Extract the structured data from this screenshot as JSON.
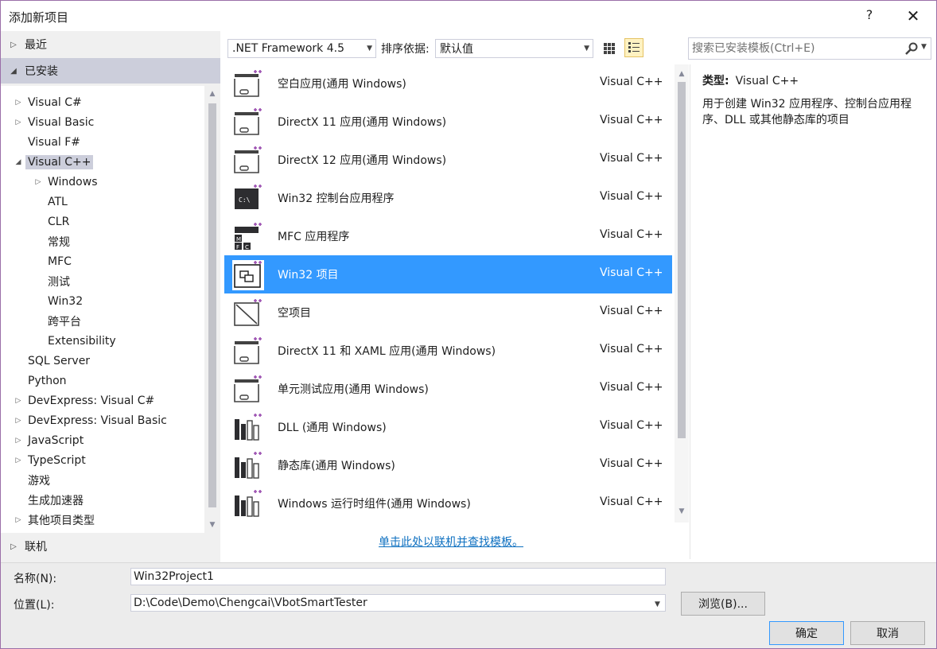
{
  "window": {
    "title": "添加新项目",
    "help_label": "?",
    "close_label": "✕"
  },
  "left": {
    "recent_label": "最近",
    "installed_label": "已安装",
    "online_label": "联机",
    "tree": [
      {
        "label": "Visual C#",
        "arrow": "▷",
        "indent": 0
      },
      {
        "label": "Visual Basic",
        "arrow": "▷",
        "indent": 0
      },
      {
        "label": "Visual F#",
        "arrow": "",
        "indent": 0
      },
      {
        "label": "Visual C++",
        "arrow": "◢",
        "indent": 0,
        "selected": true
      },
      {
        "label": "Windows",
        "arrow": "▷",
        "indent": 1
      },
      {
        "label": "ATL",
        "arrow": "",
        "indent": 1
      },
      {
        "label": "CLR",
        "arrow": "",
        "indent": 1
      },
      {
        "label": "常规",
        "arrow": "",
        "indent": 1
      },
      {
        "label": "MFC",
        "arrow": "",
        "indent": 1
      },
      {
        "label": "测试",
        "arrow": "",
        "indent": 1
      },
      {
        "label": "Win32",
        "arrow": "",
        "indent": 1
      },
      {
        "label": "跨平台",
        "arrow": "",
        "indent": 1
      },
      {
        "label": "Extensibility",
        "arrow": "",
        "indent": 1
      },
      {
        "label": "SQL Server",
        "arrow": "",
        "indent": 0
      },
      {
        "label": "Python",
        "arrow": "",
        "indent": 0
      },
      {
        "label": "DevExpress: Visual C#",
        "arrow": "▷",
        "indent": 0
      },
      {
        "label": "DevExpress: Visual Basic",
        "arrow": "▷",
        "indent": 0
      },
      {
        "label": "JavaScript",
        "arrow": "▷",
        "indent": 0
      },
      {
        "label": "TypeScript",
        "arrow": "▷",
        "indent": 0
      },
      {
        "label": "游戏",
        "arrow": "",
        "indent": 0
      },
      {
        "label": "生成加速器",
        "arrow": "",
        "indent": 0
      },
      {
        "label": "其他项目类型",
        "arrow": "▷",
        "indent": 0
      }
    ]
  },
  "toolbar": {
    "framework": ".NET Framework 4.5",
    "sort_label": "排序依据:",
    "sort_value": "默认值"
  },
  "search": {
    "placeholder": "搜索已安装模板(Ctrl+E)"
  },
  "templates": [
    {
      "name": "空白应用(通用 Windows)",
      "lang": "Visual C++",
      "icon": "blank-app-icon"
    },
    {
      "name": "DirectX 11 应用(通用 Windows)",
      "lang": "Visual C++",
      "icon": "directx-app-icon"
    },
    {
      "name": "DirectX 12 应用(通用 Windows)",
      "lang": "Visual C++",
      "icon": "directx-app-icon"
    },
    {
      "name": "Win32 控制台应用程序",
      "lang": "Visual C++",
      "icon": "console-app-icon"
    },
    {
      "name": "MFC 应用程序",
      "lang": "Visual C++",
      "icon": "mfc-app-icon"
    },
    {
      "name": "Win32 项目",
      "lang": "Visual C++",
      "icon": "win32-project-icon",
      "selected": true
    },
    {
      "name": "空项目",
      "lang": "Visual C++",
      "icon": "empty-project-icon"
    },
    {
      "name": "DirectX 11 和 XAML 应用(通用 Windows)",
      "lang": "Visual C++",
      "icon": "directx-xaml-icon"
    },
    {
      "name": "单元测试应用(通用 Windows)",
      "lang": "Visual C++",
      "icon": "unit-test-icon"
    },
    {
      "name": "DLL (通用 Windows)",
      "lang": "Visual C++",
      "icon": "dll-icon"
    },
    {
      "name": "静态库(通用 Windows)",
      "lang": "Visual C++",
      "icon": "static-lib-icon"
    },
    {
      "name": "Windows 运行时组件(通用 Windows)",
      "lang": "Visual C++",
      "icon": "runtime-component-icon"
    }
  ],
  "online_link": "单击此处以联机并查找模板。",
  "description": {
    "type_label": "类型:",
    "type_value": "Visual C++",
    "text": "用于创建 Win32 应用程序、控制台应用程序、DLL 或其他静态库的项目"
  },
  "form": {
    "name_label": "名称(N):",
    "name_value": "Win32Project1",
    "location_label": "位置(L):",
    "location_value": "D:\\Code\\Demo\\Chengcai\\VbotSmartTester",
    "browse_label": "浏览(B)...",
    "ok_label": "确定",
    "cancel_label": "取消"
  },
  "colors": {
    "accent": "#3399ff",
    "selection_gray": "#cccedb",
    "link": "#0e70c0",
    "plus_purple": "#68217a"
  }
}
